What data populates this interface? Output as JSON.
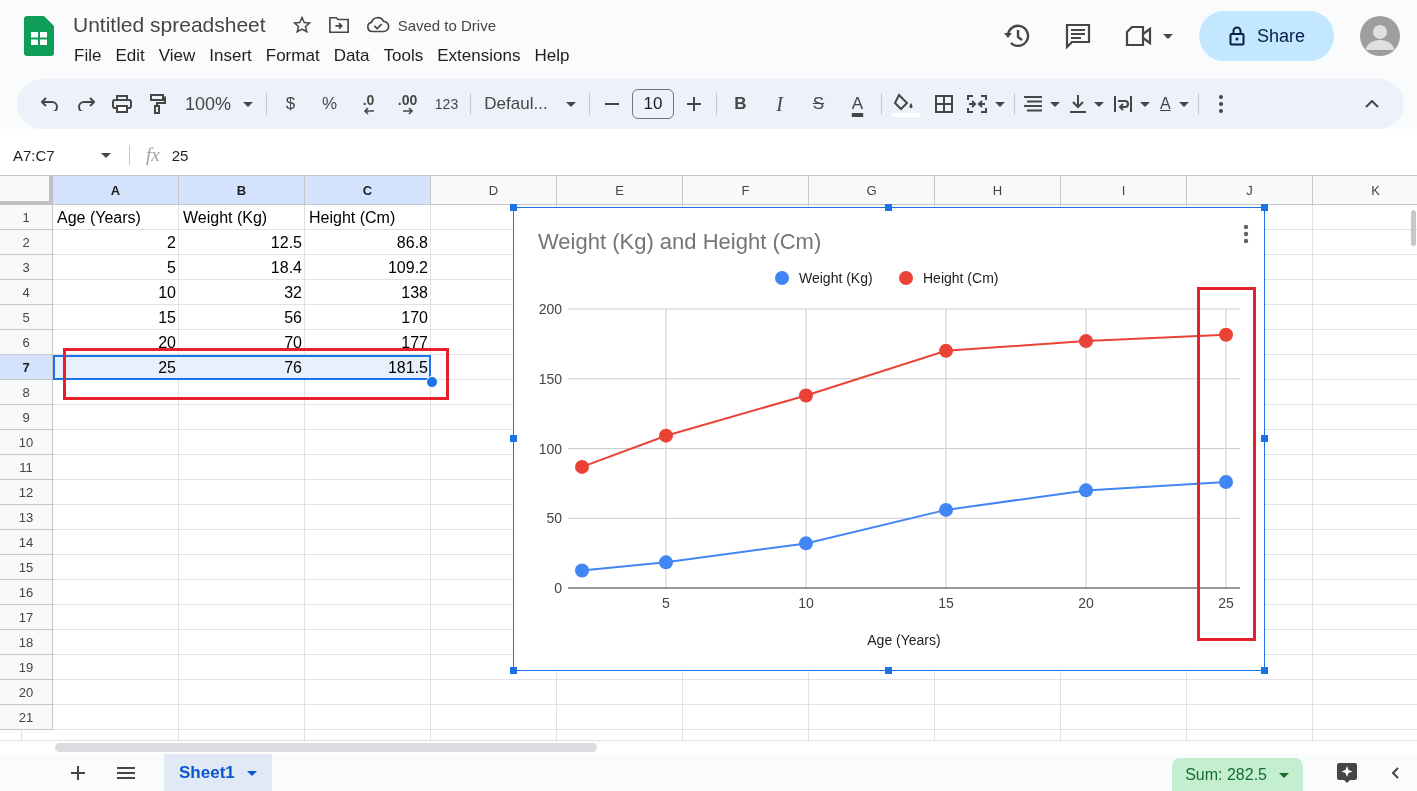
{
  "document": {
    "title": "Untitled spreadsheet",
    "save_status": "Saved to Drive"
  },
  "menu": [
    "File",
    "Edit",
    "View",
    "Insert",
    "Format",
    "Data",
    "Tools",
    "Extensions",
    "Help"
  ],
  "share_button": "Share",
  "toolbar": {
    "zoom": "100%",
    "currency": "$",
    "percent": "%",
    "decrease_decimal": ".0",
    "increase_decimal": ".00",
    "number_format": "123",
    "font": "Defaul...",
    "font_size": "10",
    "bold": "B",
    "italic": "I",
    "strikethrough": "S",
    "text_color": "A",
    "text_rotation": "A"
  },
  "formula_bar": {
    "name_box": "A7:C7",
    "fx": "fx",
    "value": "25"
  },
  "columns": [
    {
      "label": "A",
      "selected": true
    },
    {
      "label": "B",
      "selected": true
    },
    {
      "label": "C",
      "selected": true
    },
    {
      "label": "D",
      "selected": false
    },
    {
      "label": "E",
      "selected": false
    },
    {
      "label": "F",
      "selected": false
    },
    {
      "label": "G",
      "selected": false
    },
    {
      "label": "H",
      "selected": false
    },
    {
      "label": "I",
      "selected": false
    },
    {
      "label": "J",
      "selected": false
    },
    {
      "label": "K",
      "selected": false
    }
  ],
  "rows": [
    {
      "label": "1",
      "kind": "text",
      "selected": false,
      "cells": [
        "Age (Years)",
        "Weight (Kg)",
        "Height (Cm)"
      ]
    },
    {
      "label": "2",
      "kind": "number",
      "selected": false,
      "cells": [
        "2",
        "12.5",
        "86.8"
      ]
    },
    {
      "label": "3",
      "kind": "number",
      "selected": false,
      "cells": [
        "5",
        "18.4",
        "109.2"
      ]
    },
    {
      "label": "4",
      "kind": "number",
      "selected": false,
      "cells": [
        "10",
        "32",
        "138"
      ]
    },
    {
      "label": "5",
      "kind": "number",
      "selected": false,
      "cells": [
        "15",
        "56",
        "170"
      ]
    },
    {
      "label": "6",
      "kind": "number",
      "selected": false,
      "cells": [
        "20",
        "70",
        "177"
      ]
    },
    {
      "label": "7",
      "kind": "number",
      "selected": true,
      "cells": [
        "25",
        "76",
        "181.5"
      ]
    },
    {
      "label": "8",
      "kind": "empty",
      "selected": false
    },
    {
      "label": "9",
      "kind": "empty",
      "selected": false
    },
    {
      "label": "10",
      "kind": "empty",
      "selected": false
    },
    {
      "label": "11",
      "kind": "empty",
      "selected": false
    },
    {
      "label": "12",
      "kind": "empty",
      "selected": false
    },
    {
      "label": "13",
      "kind": "empty",
      "selected": false
    },
    {
      "label": "14",
      "kind": "empty",
      "selected": false
    },
    {
      "label": "15",
      "kind": "empty",
      "selected": false
    },
    {
      "label": "16",
      "kind": "empty",
      "selected": false
    },
    {
      "label": "17",
      "kind": "empty",
      "selected": false
    },
    {
      "label": "18",
      "kind": "empty",
      "selected": false
    },
    {
      "label": "19",
      "kind": "empty",
      "selected": false
    },
    {
      "label": "20",
      "kind": "empty",
      "selected": false
    },
    {
      "label": "21",
      "kind": "empty",
      "selected": false
    }
  ],
  "chart": {
    "chart_data": {
      "type": "line",
      "title": "Weight (Kg) and Height (Cm)",
      "xlabel": "Age (Years)",
      "x": [
        2,
        5,
        10,
        15,
        20,
        25
      ],
      "series": [
        {
          "name": "Weight (Kg)",
          "color": "#4285f4",
          "marker": "circle",
          "values": [
            12.5,
            18.4,
            32,
            56,
            70,
            76
          ]
        },
        {
          "name": "Height (Cm)",
          "color": "#ea4335",
          "marker": "circle",
          "values": [
            86.8,
            109.2,
            138,
            170,
            177,
            181.5
          ]
        }
      ],
      "grid": true,
      "legend": true,
      "xlim": [
        1.5,
        25.5
      ],
      "ylim": [
        0,
        200
      ],
      "xticks": [
        5,
        10,
        15,
        20,
        25
      ],
      "yticks": [
        0,
        50,
        100,
        150,
        200
      ]
    }
  },
  "sheets": [
    {
      "label": "Sheet1",
      "selected": true
    }
  ],
  "sum": "Sum: 282.5"
}
